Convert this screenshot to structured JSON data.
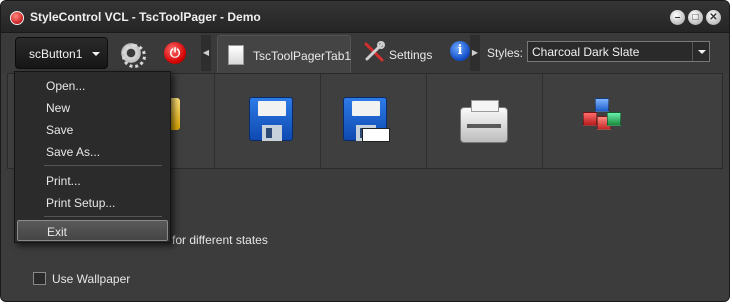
{
  "window": {
    "title": "StyleControl VCL - TscToolPager - Demo"
  },
  "toolbar": {
    "sc_button_label": "scButton1",
    "tabs": [
      {
        "label": "TscToolPagerTab1",
        "icon": "document-icon",
        "active": true
      },
      {
        "label": "Settings",
        "icon": "tools-icon",
        "active": false
      }
    ],
    "styles_label": "Styles:",
    "styles_value": "Charcoal Dark Slate"
  },
  "tool_buttons": [
    {
      "icon": "folder-icon"
    },
    {
      "icon": "save-icon"
    },
    {
      "icon": "save-as-icon"
    },
    {
      "icon": "printer-icon"
    },
    {
      "icon": "cubes-icon"
    }
  ],
  "menu": {
    "items": [
      {
        "label": "Open..."
      },
      {
        "label": "New"
      },
      {
        "label": "Save"
      },
      {
        "label": "Save As..."
      },
      {
        "label": "Print..."
      },
      {
        "label": "Print Setup..."
      },
      {
        "label": "Exit",
        "selected": true
      }
    ]
  },
  "content": {
    "hint_text": "for different states",
    "use_wallpaper_label": "Use Wallpaper",
    "use_wallpaper_checked": false
  },
  "colors": {
    "background": "#3c3c3c",
    "accent_red": "#d50000",
    "accent_blue": "#1450c8"
  }
}
